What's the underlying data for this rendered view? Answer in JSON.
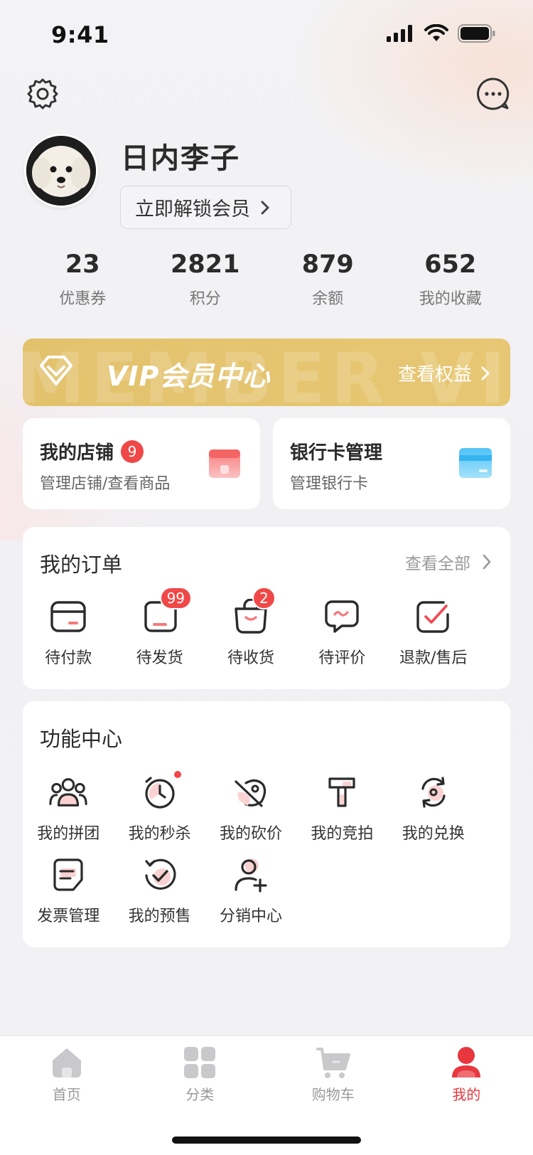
{
  "status_bar": {
    "time": "9:41"
  },
  "profile": {
    "name": "日内李子",
    "unlock_label": "立即解锁会员",
    "avatar_icon": "puppy-avatar"
  },
  "stats": [
    {
      "value": "23",
      "label": "优惠券"
    },
    {
      "value": "2821",
      "label": "积分"
    },
    {
      "value": "879",
      "label": "余额"
    },
    {
      "value": "652",
      "label": "我的收藏"
    }
  ],
  "vip_banner": {
    "title": "VIP会员中心",
    "link": "查看权益",
    "watermark": "MEMBER VIP",
    "color": "#e5c46f"
  },
  "shop_card": {
    "title": "我的店铺",
    "badge": "9",
    "subtitle": "管理店铺/查看商品",
    "icon": "shop-icon"
  },
  "bank_card": {
    "title": "银行卡管理",
    "subtitle": "管理银行卡",
    "icon": "bank-card-icon"
  },
  "orders": {
    "title": "我的订单",
    "view_all": "查看全部",
    "items": [
      {
        "label": "待付款",
        "icon": "wallet-icon",
        "badge": ""
      },
      {
        "label": "待发货",
        "icon": "package-icon",
        "badge": "99"
      },
      {
        "label": "待收货",
        "icon": "bag-icon",
        "badge": "2"
      },
      {
        "label": "待评价",
        "icon": "chat-bubble-icon",
        "badge": ""
      },
      {
        "label": "退款/售后",
        "icon": "checkbox-icon",
        "badge": ""
      }
    ]
  },
  "functions": {
    "title": "功能中心",
    "items": [
      {
        "label": "我的拼团",
        "icon": "group-icon"
      },
      {
        "label": "我的秒杀",
        "icon": "alarm-clock-icon"
      },
      {
        "label": "我的砍价",
        "icon": "cut-price-icon"
      },
      {
        "label": "我的竞拍",
        "icon": "auction-hammer-icon"
      },
      {
        "label": "我的兑换",
        "icon": "exchange-icon"
      },
      {
        "label": "发票管理",
        "icon": "invoice-icon"
      },
      {
        "label": "我的预售",
        "icon": "presale-icon"
      },
      {
        "label": "分销中心",
        "icon": "add-user-icon"
      }
    ]
  },
  "tabbar": [
    {
      "label": "首页",
      "icon": "home-icon",
      "active": false
    },
    {
      "label": "分类",
      "icon": "category-icon",
      "active": false
    },
    {
      "label": "购物车",
      "icon": "cart-icon",
      "active": false
    },
    {
      "label": "我的",
      "icon": "user-icon",
      "active": true
    }
  ],
  "colors": {
    "accent": "#e8373f",
    "badge": "#f04848",
    "gold": "#e5c46f",
    "background": "#f2f2f4"
  }
}
